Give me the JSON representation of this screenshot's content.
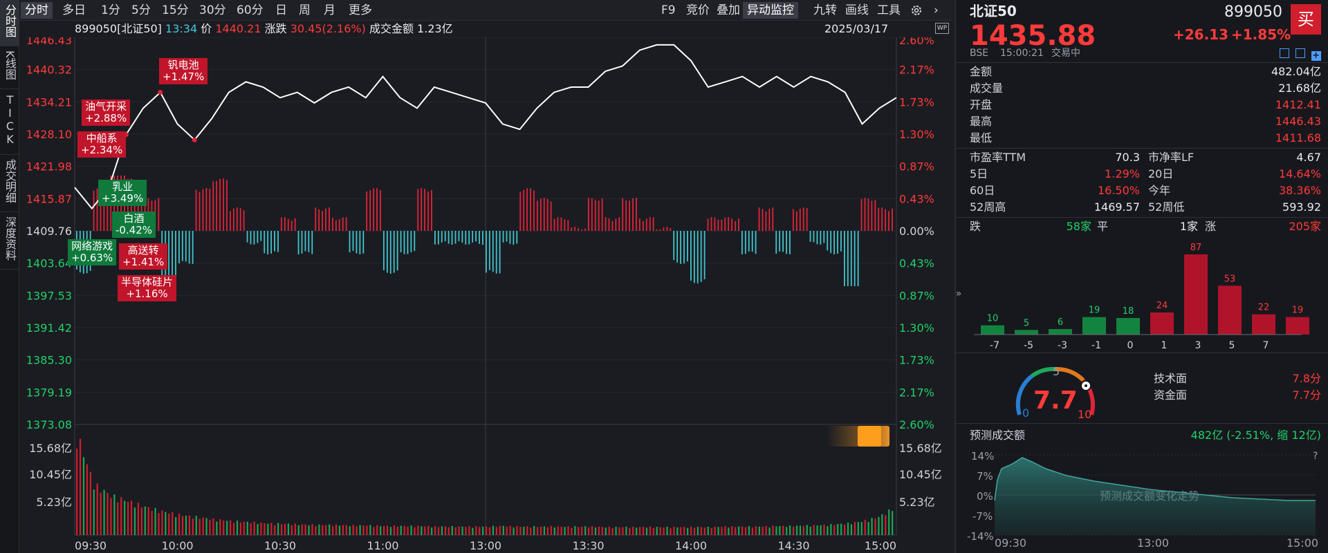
{
  "vtabs": [
    "分时图",
    "K线图",
    "TICK",
    "成交明细",
    "深度资料"
  ],
  "toolbar": {
    "periods": [
      "分时",
      "多日",
      "1分",
      "5分",
      "15分",
      "30分",
      "60分",
      "日",
      "周",
      "月",
      "更多"
    ],
    "tools": [
      "F9",
      "竞价",
      "叠加",
      "异动监控",
      "九转",
      "画线",
      "工具"
    ],
    "gear_icon": "gear-icon",
    "next_icon": "chevron-right-icon"
  },
  "info": {
    "code_name": "899050[北证50]",
    "time": "13:34",
    "price_label": "价",
    "price": "1440.21",
    "change_label": "涨跌",
    "change": "30.45(2.16%)",
    "amount_label": "成交金额",
    "amount": "1.23亿",
    "date": "2025/03/17",
    "wp_label": "WP"
  },
  "axes": {
    "price_ticks": [
      "1446.43",
      "1440.32",
      "1434.21",
      "1428.10",
      "1421.98",
      "1415.87",
      "1409.76",
      "1403.64",
      "1397.53",
      "1391.42",
      "1385.30",
      "1379.19",
      "1373.08"
    ],
    "pct_ticks": [
      "2.60%",
      "2.17%",
      "1.73%",
      "1.30%",
      "0.87%",
      "0.43%",
      "0.00%",
      "0.43%",
      "0.87%",
      "1.30%",
      "1.73%",
      "2.17%",
      "2.60%"
    ],
    "vol_ticks": [
      "15.68亿",
      "10.45亿",
      "5.23亿"
    ],
    "time_ticks": [
      "09:30",
      "10:00",
      "10:30",
      "11:00",
      "13:00",
      "13:30",
      "14:00",
      "14:30",
      "15:00"
    ]
  },
  "tags": [
    {
      "name": "钒电池",
      "pct": "+1.47%",
      "color": "red"
    },
    {
      "name": "油气开采",
      "pct": "+2.88%",
      "color": "red"
    },
    {
      "name": "中船系",
      "pct": "+2.34%",
      "color": "red"
    },
    {
      "name": "乳业",
      "pct": "+3.49%",
      "color": "green"
    },
    {
      "name": "白酒",
      "pct": "-0.42%",
      "color": "green"
    },
    {
      "name": "网络游戏",
      "pct": "+0.63%",
      "color": "green"
    },
    {
      "name": "高送转",
      "pct": "+1.41%",
      "color": "red"
    },
    {
      "name": "半导体硅片",
      "pct": "+1.16%",
      "color": "red"
    }
  ],
  "quote": {
    "name": "北证50",
    "code": "899050",
    "price": "1435.88",
    "change": "+26.13",
    "change_pct": "+1.85%",
    "buy_label": "买",
    "exchange": "BSE",
    "time": "15:00:21",
    "status": "交易中",
    "rows": [
      {
        "label": "金额",
        "value": "482.04亿",
        "color": "white"
      },
      {
        "label": "成交量",
        "value": "21.68亿",
        "color": "white"
      },
      {
        "label": "开盘",
        "value": "1412.41",
        "color": "red"
      },
      {
        "label": "最高",
        "value": "1446.43",
        "color": "red"
      },
      {
        "label": "最低",
        "value": "1411.68",
        "color": "red"
      }
    ],
    "grid": [
      {
        "l1": "市盈率TTM",
        "v1": "70.3",
        "c1": "white",
        "l2": "市净率LF",
        "v2": "4.67",
        "c2": "white"
      },
      {
        "l1": "5日",
        "v1": "1.29%",
        "c1": "red",
        "l2": "20日",
        "v2": "14.64%",
        "c2": "red"
      },
      {
        "l1": "60日",
        "v1": "16.50%",
        "c1": "red",
        "l2": "今年",
        "v2": "38.36%",
        "c2": "red"
      },
      {
        "l1": "52周高",
        "v1": "1469.57",
        "c1": "white",
        "l2": "52周低",
        "v2": "593.92",
        "c2": "white"
      }
    ],
    "breadth": {
      "down_label": "跌",
      "down": "58家",
      "flat_label": "平",
      "flat": "1家",
      "up_label": "涨",
      "up": "205家"
    }
  },
  "distribution": {
    "values": [
      10,
      5,
      6,
      19,
      18,
      24,
      87,
      53,
      22,
      19
    ],
    "colors": [
      "green",
      "green",
      "green",
      "green",
      "green",
      "red",
      "red",
      "red",
      "red",
      "red"
    ],
    "ticks": [
      "-7",
      "-5",
      "-3",
      "-1",
      "0",
      "1",
      "3",
      "5",
      "7"
    ]
  },
  "gauge": {
    "score": "7.7",
    "min": "0",
    "mid": "5",
    "max": "10",
    "tech_label": "技术面",
    "tech_value": "7.8分",
    "fund_label": "资金面",
    "fund_value": "7.7分"
  },
  "forecast": {
    "title": "预测成交额",
    "value": "482亿 (-2.51%, 缩 12亿)",
    "y_ticks": [
      "14%",
      "7%",
      "0%",
      "-7%",
      "-14%"
    ],
    "x_ticks": [
      "09:30",
      "13:00",
      "15:00"
    ],
    "watermark": "预测成交额变化走势",
    "help": "?"
  },
  "chart_data": {
    "type": "line",
    "title": "",
    "xlabel": "",
    "ylabel": "",
    "ylim": [
      1373.08,
      1446.43
    ],
    "prev_close": 1409.76,
    "x": [
      "09:30",
      "09:35",
      "09:40",
      "09:45",
      "09:50",
      "09:55",
      "10:00",
      "10:05",
      "10:10",
      "10:15",
      "10:20",
      "10:25",
      "10:30",
      "10:35",
      "10:40",
      "10:45",
      "10:50",
      "10:55",
      "11:00",
      "11:05",
      "11:10",
      "11:15",
      "11:20",
      "11:25",
      "11:30",
      "13:05",
      "13:10",
      "13:15",
      "13:20",
      "13:25",
      "13:30",
      "13:35",
      "13:40",
      "13:45",
      "13:50",
      "13:55",
      "14:00",
      "14:05",
      "14:10",
      "14:15",
      "14:20",
      "14:25",
      "14:30",
      "14:35",
      "14:40",
      "14:45",
      "14:50",
      "14:55",
      "15:00"
    ],
    "series": [
      {
        "values": [
          1418,
          1414,
          1418,
          1428,
          1433,
          1436,
          1430,
          1427,
          1431,
          1436,
          1438,
          1437,
          1435,
          1436,
          1434,
          1436,
          1437,
          1435,
          1439,
          1435,
          1433,
          1437,
          1436,
          1435,
          1434,
          1430,
          1429,
          1433,
          1436,
          1437,
          1437,
          1440,
          1441,
          1444,
          1445,
          1445,
          1442,
          1437,
          1438,
          1439,
          1437,
          1439,
          1437,
          1439,
          1438,
          1436,
          1430,
          1433,
          1435
        ]
      },
      {
        "values": [
          1416,
          1413,
          1416,
          1424,
          1429,
          1432,
          1430,
          1428,
          1429,
          1432,
          1434,
          1434,
          1434,
          1434,
          1434,
          1434,
          1435,
          1435,
          1435,
          1435,
          1434,
          1435,
          1435,
          1435,
          1435,
          1434,
          1433,
          1433,
          1434,
          1434,
          1435,
          1436,
          1436,
          1437,
          1438,
          1438,
          1438,
          1437,
          1437,
          1437,
          1437,
          1437,
          1437,
          1437,
          1437,
          1437,
          1436,
          1436,
          1436
        ]
      }
    ],
    "volume_ylim": [
      0,
      18
    ],
    "volume": [
      18,
      9,
      7,
      6,
      5,
      4.2,
      3.6,
      3.2,
      2.8,
      2.5,
      2.3,
      2.1,
      2.0,
      1.9,
      1.8,
      1.8,
      1.7,
      1.7,
      1.6,
      1.6,
      1.6,
      1.5,
      1.5,
      1.5,
      1.5,
      1.6,
      1.5,
      1.5,
      1.5,
      1.5,
      1.5,
      1.4,
      1.4,
      1.4,
      1.4,
      1.4,
      1.4,
      1.4,
      1.5,
      1.5,
      1.5,
      1.6,
      1.6,
      1.7,
      1.8,
      2.0,
      2.4,
      3.2,
      5.0
    ]
  }
}
